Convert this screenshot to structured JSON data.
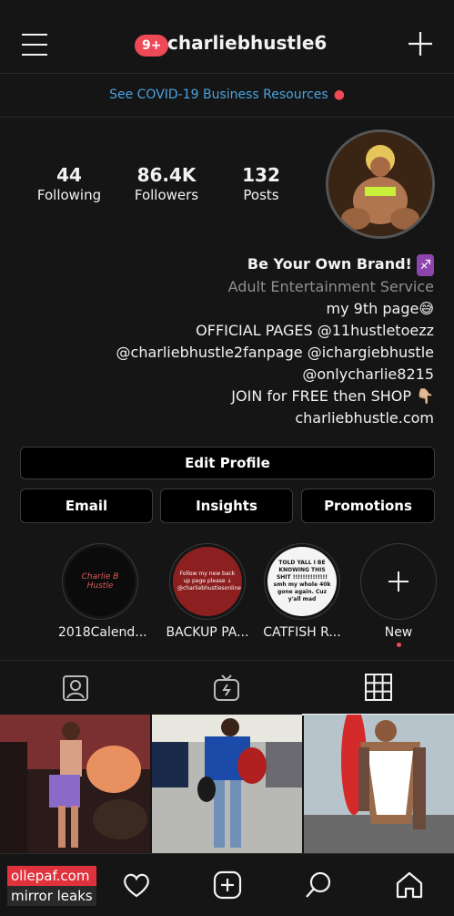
{
  "header": {
    "username": "charliebhustle6",
    "notification_badge": "9+"
  },
  "banner": {
    "text": "See COVID-19 Business Resources"
  },
  "stats": [
    {
      "num": "44",
      "label": "Following"
    },
    {
      "num": "86.4K",
      "label": "Followers"
    },
    {
      "num": "132",
      "label": "Posts"
    }
  ],
  "bio": {
    "name": "Be Your Own Brand!",
    "category": "Adult Entertainment Service",
    "lines": [
      "my 9th page😅",
      "OFFICIAL PAGES @11hustletoezz",
      "@charliebhustle2fanpage @ichargiebhustle",
      "@onlycharlie8215",
      "JOIN for FREE then SHOP 👇🏼",
      "charliebhustle.com"
    ]
  },
  "buttons": {
    "edit_profile": "Edit Profile",
    "email": "Email",
    "insights": "Insights",
    "promotions": "Promotions"
  },
  "highlights": [
    {
      "label": "2018Calend...",
      "thumb_text": "Charlie B Hustle"
    },
    {
      "label": "BACKUP PA...",
      "thumb_text": "Follow my new back up page please ↓ @charliebhustlesonline"
    },
    {
      "label": "CATFISH R...",
      "thumb_text": "TOLD YALL I BE KNOWING THIS SHIT !!!!!!!!!!!!!! smh my whole 40k gone again. Cuz y'all mad"
    },
    {
      "label": "New",
      "thumb_text": ""
    }
  ],
  "watermark": {
    "line1": "ollepaf.com",
    "line2": "mirror leaks"
  },
  "colors": {
    "background": "#151515",
    "accent_blue": "#4aa3df",
    "badge_red": "#ed4956"
  }
}
